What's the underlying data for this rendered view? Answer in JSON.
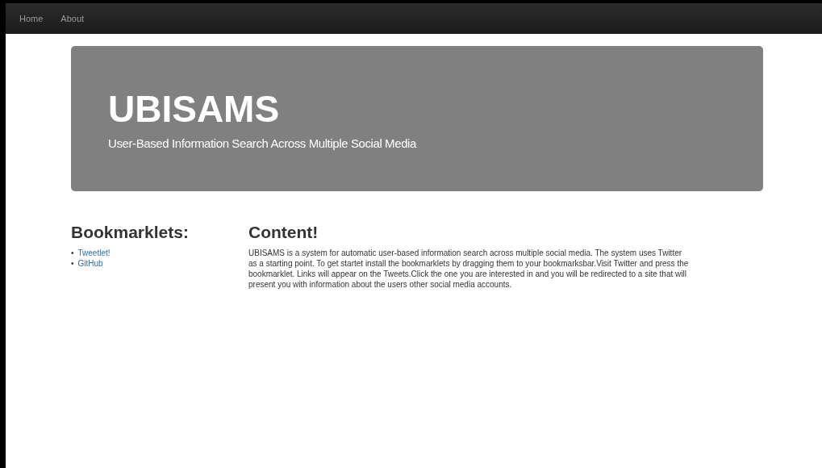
{
  "navbar": {
    "links": [
      {
        "label": "Home"
      },
      {
        "label": "About"
      }
    ]
  },
  "jumbotron": {
    "title": "UBISAMS",
    "subtitle": "User-Based Information Search Across Multiple Social Media"
  },
  "sidebar": {
    "heading": "Bookmarklets:",
    "links": [
      {
        "bullet": "•",
        "label": "Tweetlet!"
      },
      {
        "bullet": "•",
        "label": "GitHub"
      }
    ]
  },
  "content": {
    "heading": "Content!",
    "text": "UBISAMS is a system for automatic user-based information search across multiple social media. The system uses Twitter as a starting point. To get startet install the bookmarklets by dragging them to your bookmarksbar.Visit Twitter and press the bookmarklet. Links will appear on the Tweets.Click the one you are interested in and you will be redirected to a site that will present you with information about the users other social media accounts."
  }
}
